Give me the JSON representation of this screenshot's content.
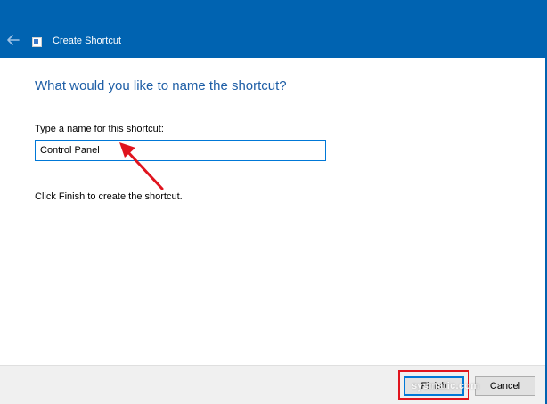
{
  "window": {
    "title": "Create Shortcut",
    "back_icon": "back-arrow-icon",
    "app_icon": "shortcut-icon"
  },
  "main": {
    "heading": "What would you like to name the shortcut?",
    "field_label": "Type a name for this shortcut:",
    "name_value": "Control Panel",
    "info_text": "Click Finish to create the shortcut."
  },
  "footer": {
    "finish_label": "Finish",
    "cancel_label": "Cancel",
    "watermark": "sysmatic.com"
  },
  "colors": {
    "accent": "#0063b1",
    "heading": "#1e5ea6",
    "annotation": "#e0141e"
  }
}
